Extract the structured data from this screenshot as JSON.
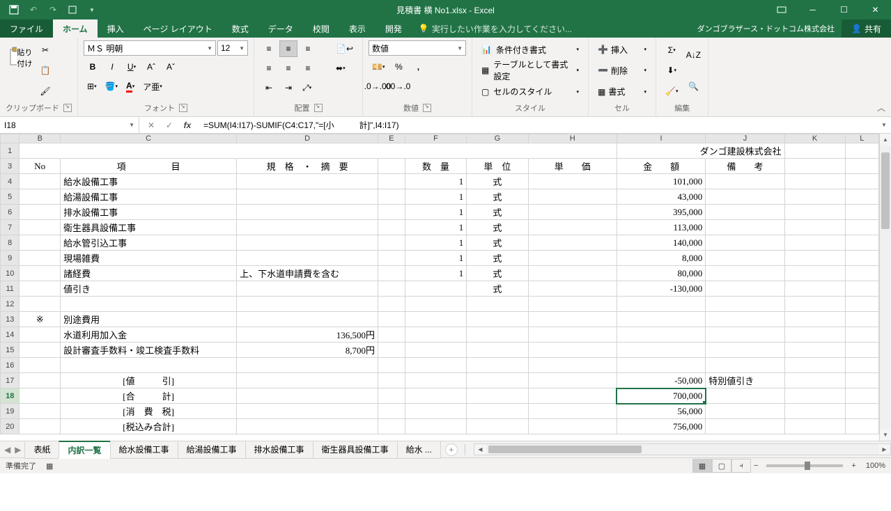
{
  "titlebar": {
    "title": "見積書 横 No1.xlsx - Excel"
  },
  "tabs": {
    "file": "ファイル",
    "home": "ホーム",
    "insert": "挿入",
    "pagelayout": "ページ レイアウト",
    "formulas": "数式",
    "data": "データ",
    "review": "校閲",
    "view": "表示",
    "developer": "開発",
    "tellme": "実行したい作業を入力してください...",
    "account": "ダンゴブラザース・ドットコム株式会社",
    "share": "共有"
  },
  "ribbon": {
    "paste": "貼り付け",
    "clipboard": "クリップボード",
    "font_name": "ＭＳ 明朝",
    "font_size": "12",
    "font": "フォント",
    "alignment": "配置",
    "number_format": "数値",
    "number": "数値",
    "cond_fmt": "条件付き書式",
    "table_fmt": "テーブルとして書式設定",
    "cell_style": "セルのスタイル",
    "styles": "スタイル",
    "insert": "挿入",
    "delete": "削除",
    "format": "書式",
    "cells": "セル",
    "editing": "編集"
  },
  "namebox": "I18",
  "formula": "=SUM(I4:I17)-SUMIF(C4:C17,\"=[小　　　計]\",I4:I17)",
  "cols": [
    "",
    "B",
    "C",
    "D",
    "E",
    "F",
    "G",
    "H",
    "I",
    "J",
    "K",
    "L"
  ],
  "company": "ダンゴ建設株式会社",
  "headers": {
    "no": "No",
    "item": "項　　　　　目",
    "spec": "規　格　・　摘　要",
    "qty": "数　量",
    "unit": "単　位",
    "price": "単　　価",
    "amount": "金　　額",
    "note": "備　　考"
  },
  "rows": [
    {
      "r": "4",
      "c": "給水設備工事",
      "d": "",
      "f": "1",
      "g": "式",
      "i": "101,000",
      "j": ""
    },
    {
      "r": "5",
      "c": "給湯設備工事",
      "d": "",
      "f": "1",
      "g": "式",
      "i": "43,000",
      "j": ""
    },
    {
      "r": "6",
      "c": "排水設備工事",
      "d": "",
      "f": "1",
      "g": "式",
      "i": "395,000",
      "j": ""
    },
    {
      "r": "7",
      "c": "衛生器具設備工事",
      "d": "",
      "f": "1",
      "g": "式",
      "i": "113,000",
      "j": ""
    },
    {
      "r": "8",
      "c": "給水管引込工事",
      "d": "",
      "f": "1",
      "g": "式",
      "i": "140,000",
      "j": ""
    },
    {
      "r": "9",
      "c": "現場雑費",
      "d": "",
      "f": "1",
      "g": "式",
      "i": "8,000",
      "j": ""
    },
    {
      "r": "10",
      "c": "諸経費",
      "d": "上、下水道申請費を含む",
      "f": "1",
      "g": "式",
      "i": "80,000",
      "j": ""
    },
    {
      "r": "11",
      "c": "値引き",
      "d": "",
      "f": "",
      "g": "式",
      "i": "-130,000",
      "j": ""
    },
    {
      "r": "12",
      "c": "",
      "d": "",
      "f": "",
      "g": "",
      "i": "",
      "j": ""
    }
  ],
  "extra": {
    "mark": "※",
    "title": "別途費用",
    "r14c": "水道利用加入金",
    "r14d": "136,500円",
    "r15c": "設計審査手数料・竣工検査手数料",
    "r15d": "8,700円",
    "r17c": "[値　　　引]",
    "r17i": "-50,000",
    "r17j": "特別値引き",
    "r18c": "[合　　　計]",
    "r18i": "700,000",
    "r19c": "[消　費　税]",
    "r19i": "56,000",
    "r20c": "[税込み合計]",
    "r20i": "756,000"
  },
  "sheettabs": [
    "表紙",
    "内訳一覧",
    "給水設備工事",
    "給湯設備工事",
    "排水設備工事",
    "衛生器具設備工事",
    "給水 ..."
  ],
  "status": {
    "ready": "準備完了",
    "zoom": "100%"
  },
  "chart_data": null
}
